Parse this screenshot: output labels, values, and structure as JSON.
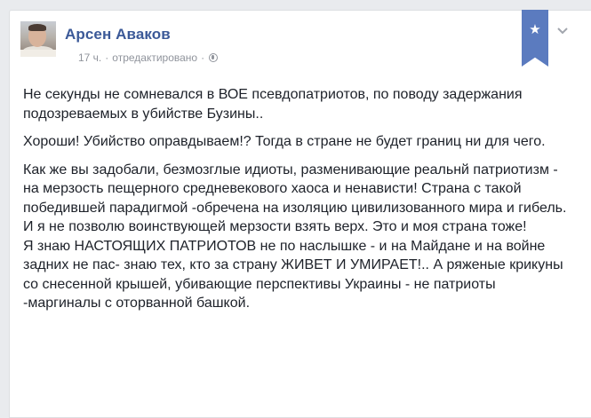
{
  "post": {
    "author": "Арсен Аваков",
    "time": "17 ч.",
    "separator": "·",
    "edited": "отредактировано",
    "paragraphs": [
      "Не секунды не сомневался в ВОЕ псевдопатриотов, по поводу задержания подозреваемых в убийстве Бузины..",
      "Хороши! Убийство оправдываем!? Тогда в стране не будет границ ни для чего.",
      "Как же вы задобали, безмозглые идиоты, разменивающие реальнй патриотизм - на мерзость пещерного средневекового хаоса и ненависти! Страна с такой победившей парадигмой -обречена на изоляцию цивилизованного мира и гибель.",
      "И я не позволю воинствующей мерзости взять верх. Это и моя страна тоже!",
      "Я знаю НАСТОЯЩИХ ПАТРИОТОВ не по наслышке - и на Майдане и на войне задних не пас- знаю тех, кто за страну ЖИВЕТ И УМИРАЕТ!.. А ряженые крикуны со снесенной крышей, убивающие перспективы Украины - не патриоты -маргиналы с оторванной башкой."
    ]
  },
  "icons": {
    "avatar": "author-avatar",
    "globe": "globe-icon",
    "bookmark": "star-icon",
    "menu": "chevron-down-icon"
  },
  "colors": {
    "author_link": "#3b5998",
    "meta_text": "#90949c",
    "bookmark_ribbon": "#5b7bbf",
    "body_text": "#1d2129"
  }
}
